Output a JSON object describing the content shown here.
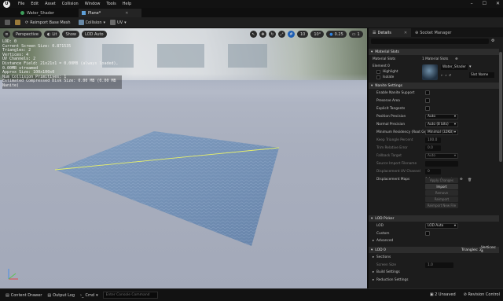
{
  "menu": [
    "File",
    "Edit",
    "Asset",
    "Collision",
    "Window",
    "Tools",
    "Help"
  ],
  "tabs": [
    {
      "label": "Water_Shader",
      "active": false
    },
    {
      "label": "Plane*",
      "active": true
    }
  ],
  "toolbar": {
    "reimport": "Reimport Base Mesh",
    "collision": "Collision",
    "uv": "UV"
  },
  "viewport": {
    "perspective": "Perspective",
    "lit": "Lit",
    "show": "Show",
    "lod": "LOD Auto",
    "grid_value": "10",
    "angle_value": "10°",
    "scale_value": "0.25",
    "camera_speed": "1",
    "stats": [
      "LOD:  0",
      "Current Screen Size:  0.871535",
      "Triangles:  2",
      "Vertices:  4",
      "UV Channels:  2",
      "Distance Field:  21x21x1 = 0.00MB (always loaded), 0.00MB streamed",
      "Approx Size:  100x100x0",
      "Num Collision Primitives:  1",
      "Estimated Compressed Disk Size:  0.00 MB (0.00 MB Nanite)"
    ]
  },
  "panel": {
    "tab_details": "Details",
    "tab_socket": "Socket Manager",
    "section_material_slots": "Material Slots",
    "material_slots_label": "Material Slots",
    "material_slots_value": "1 Material Slots",
    "element_label": "Element 0",
    "highlight": "Highlight",
    "isolate": "Isolate",
    "material_name": "Water_Shader",
    "slot_name": "Slot Name",
    "section_nanite": "Nanite Settings",
    "rows": [
      {
        "label": "Enable Nanite Support",
        "kind": "check"
      },
      {
        "label": "Preserve Area",
        "kind": "check"
      },
      {
        "label": "Explicit Tangents",
        "kind": "check"
      },
      {
        "label": "Position Precision",
        "kind": "dd",
        "value": "Auto"
      },
      {
        "label": "Normal Precision",
        "kind": "dd",
        "value": "Auto (8 bits)"
      },
      {
        "label": "Minimum Residency (Root Geo)",
        "kind": "dd",
        "value": "Minimal (32KB)"
      },
      {
        "label": "Keep Triangle Percent",
        "kind": "num",
        "value": "100.0",
        "dim": true
      },
      {
        "label": "Trim Relative Error",
        "kind": "num",
        "value": "0.0",
        "dim": true
      },
      {
        "label": "Fallback Target",
        "kind": "dd",
        "value": "Auto",
        "dim": true
      },
      {
        "label": "Source Import Filename",
        "kind": "num",
        "value": "",
        "dim": true
      },
      {
        "label": "Displacement UV Channel",
        "kind": "num",
        "value": "0",
        "dim": true
      },
      {
        "label": "Displacement Maps",
        "kind": "text",
        "value": "0 Array element"
      }
    ],
    "buttons": [
      {
        "label": "Apply Changes",
        "dim": true
      },
      {
        "label": "Import",
        "dim": false
      },
      {
        "label": "Remove",
        "dim": true
      },
      {
        "label": "Reimport",
        "dim": true
      },
      {
        "label": "Reimport New File",
        "dim": true
      }
    ],
    "section_lod_picker": "LOD Picker",
    "lod_label": "LOD",
    "lod_value": "LOD Auto",
    "custom_label": "Custom",
    "advanced": "Advanced",
    "section_lod0": "LOD 0",
    "lod0_tris": "Triangles: 2",
    "lod0_verts": "Vertices: 4",
    "sections_label": "Sections",
    "screen_size_label": "Screen Size",
    "screen_size_value": "1.0",
    "build_settings": "Build Settings",
    "reduction_settings": "Reduction Settings"
  },
  "statusbar": {
    "content_drawer": "Content Drawer",
    "output_log": "Output Log",
    "cmd": "Cmd",
    "console_placeholder": "Enter Console Command",
    "unsaved": "2 Unsaved",
    "revision": "Revision Control"
  },
  "colors": {
    "accent_blue": "#1e5fb4",
    "ui_dark": "#1c1c1c",
    "edge_yellow": "#e8f06a"
  }
}
